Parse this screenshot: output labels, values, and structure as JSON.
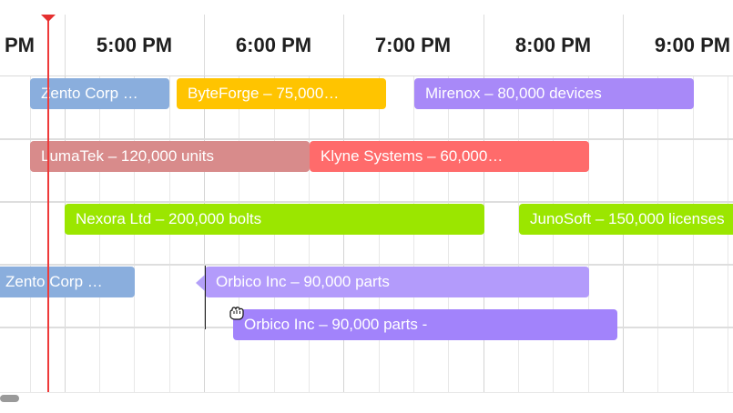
{
  "timeline": {
    "hours": [
      "PM",
      "5:00 PM",
      "6:00 PM",
      "7:00 PM",
      "8:00 PM",
      "9:00 PM"
    ]
  },
  "colors": {
    "blue": "#8aaedd",
    "gold": "#ffc400",
    "violet": "#a889f8",
    "rose": "#d88b8b",
    "red": "#ff6b6b",
    "green": "#9be600",
    "lavender": "#b39bfb",
    "purple": "#a283fb",
    "now_line": "#ee3a3a"
  },
  "events": [
    {
      "label": "Zento Corp …",
      "color": "blue"
    },
    {
      "label": "ByteForge – 75,000…",
      "color": "gold"
    },
    {
      "label": "Mirenox – 80,000 devices",
      "color": "violet"
    },
    {
      "label": "LumaTek – 120,000 units",
      "color": "rose"
    },
    {
      "label": "Klyne Systems – 60,000…",
      "color": "red"
    },
    {
      "label": "Nexora Ltd – 200,000 bolts",
      "color": "green"
    },
    {
      "label": "JunoSoft – 150,000 licenses",
      "color": "green"
    },
    {
      "label": "Zento Corp …",
      "color": "blue"
    },
    {
      "label": "Orbico Inc – 90,000 parts",
      "color": "lavender"
    },
    {
      "label": "Orbico Inc – 90,000 parts -",
      "color": "purple"
    }
  ],
  "icons": {
    "now_marker": "triangle-down-icon",
    "drag_cursor": "grab-hand-icon",
    "drag_arrow": "chevron-left-icon"
  }
}
